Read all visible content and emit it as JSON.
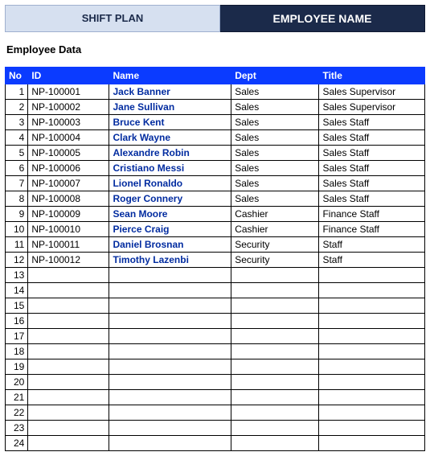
{
  "header": {
    "shift_plan": "SHIFT PLAN",
    "employee_name": "EMPLOYEE NAME"
  },
  "section_title": "Employee Data",
  "columns": {
    "no": "No",
    "id": "ID",
    "name": "Name",
    "dept": "Dept",
    "title": "Title"
  },
  "total_rows": 24,
  "rows": [
    {
      "no": 1,
      "id": "NP-100001",
      "name": "Jack Banner",
      "dept": "Sales",
      "title": "Sales Supervisor"
    },
    {
      "no": 2,
      "id": "NP-100002",
      "name": "Jane Sullivan",
      "dept": "Sales",
      "title": "Sales Supervisor"
    },
    {
      "no": 3,
      "id": "NP-100003",
      "name": "Bruce Kent",
      "dept": "Sales",
      "title": "Sales Staff"
    },
    {
      "no": 4,
      "id": "NP-100004",
      "name": "Clark Wayne",
      "dept": "Sales",
      "title": "Sales Staff"
    },
    {
      "no": 5,
      "id": "NP-100005",
      "name": "Alexandre Robin",
      "dept": "Sales",
      "title": "Sales Staff"
    },
    {
      "no": 6,
      "id": "NP-100006",
      "name": "Cristiano Messi",
      "dept": "Sales",
      "title": "Sales Staff"
    },
    {
      "no": 7,
      "id": "NP-100007",
      "name": "Lionel Ronaldo",
      "dept": "Sales",
      "title": "Sales Staff"
    },
    {
      "no": 8,
      "id": "NP-100008",
      "name": "Roger Connery",
      "dept": "Sales",
      "title": "Sales Staff"
    },
    {
      "no": 9,
      "id": "NP-100009",
      "name": "Sean Moore",
      "dept": "Cashier",
      "title": "Finance Staff"
    },
    {
      "no": 10,
      "id": "NP-100010",
      "name": "Pierce Craig",
      "dept": "Cashier",
      "title": "Finance Staff"
    },
    {
      "no": 11,
      "id": "NP-100011",
      "name": "Daniel Brosnan",
      "dept": "Security",
      "title": "Staff"
    },
    {
      "no": 12,
      "id": "NP-100012",
      "name": "Timothy Lazenbi",
      "dept": "Security",
      "title": "Staff"
    }
  ]
}
